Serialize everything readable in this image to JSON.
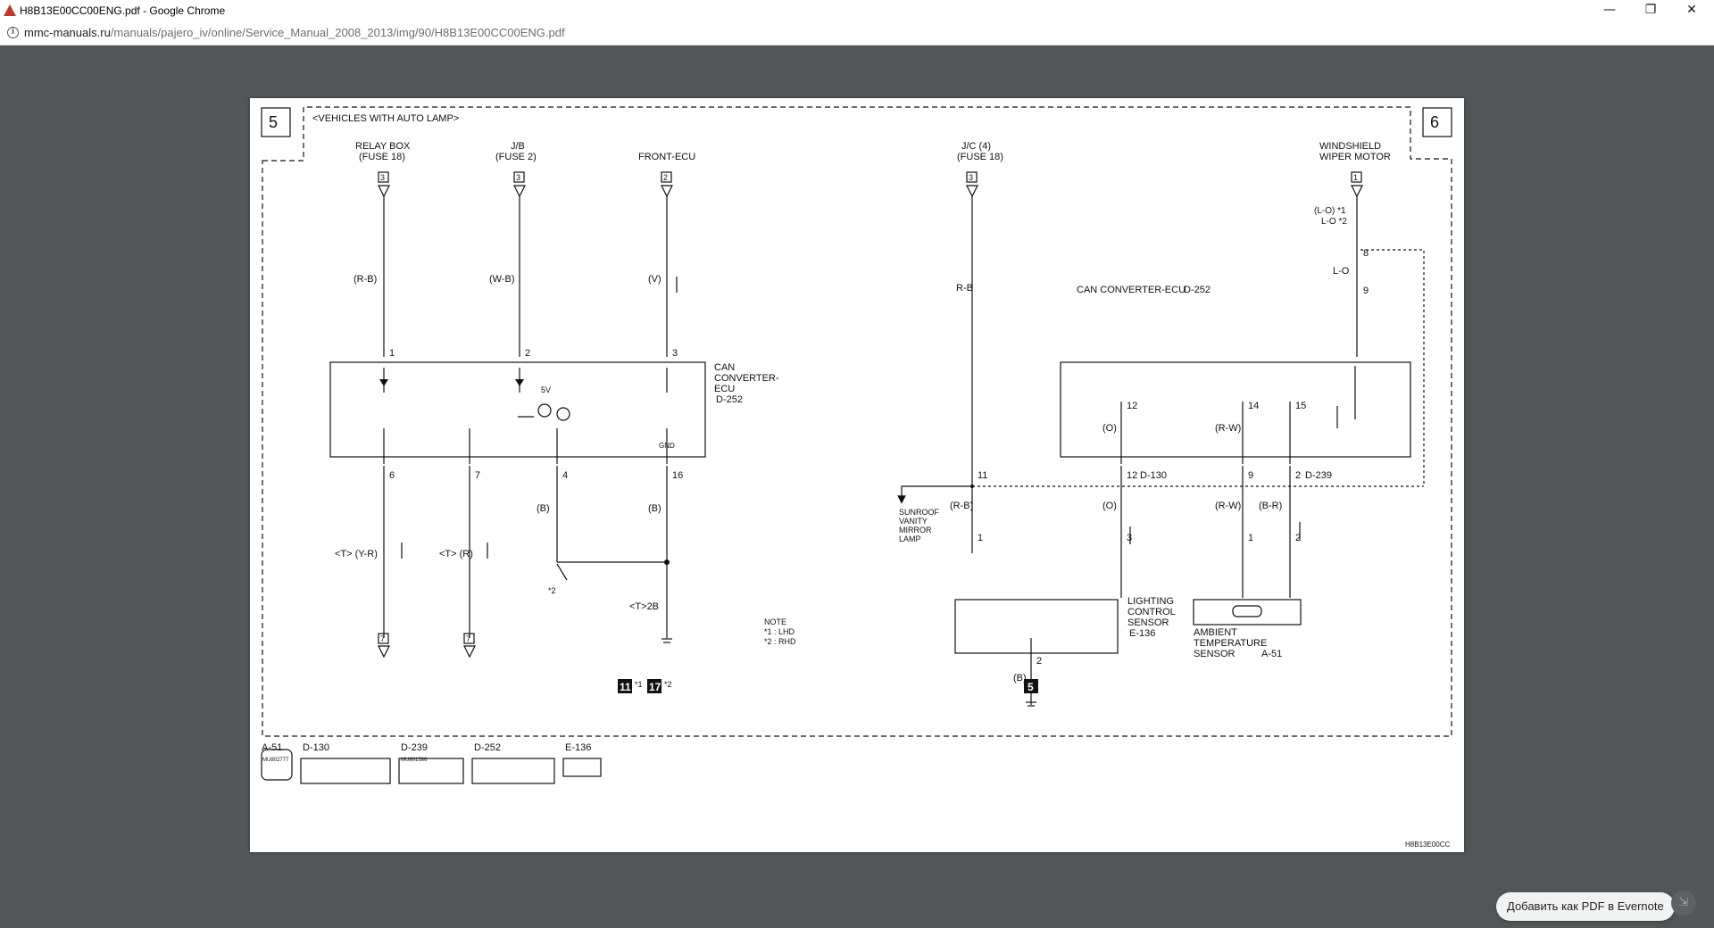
{
  "window": {
    "title": "H8B13E00CC00ENG.pdf - Google Chrome",
    "minimize": "—",
    "restore": "❐",
    "close": "✕"
  },
  "address": {
    "domain": "mmc-manuals.ru",
    "path": "/manuals/pajero_iv/online/Service_Manual_2008_2013/img/90/H8B13E00CC00ENG.pdf"
  },
  "diagram": {
    "page_left": "5",
    "page_right": "6",
    "variant": "<VEHICLES WITH AUTO LAMP>",
    "relay_box_1": "RELAY BOX",
    "relay_box_2": "(FUSE 18)",
    "jb_1": "J/B",
    "jb_2": "(FUSE 2)",
    "front_ecu": "FRONT-ECU",
    "jc_1": "J/C (4)",
    "jc_2": "(FUSE 18)",
    "wiper_1": "WINDSHIELD",
    "wiper_2": "WIPER MOTOR",
    "conn_3a": "3",
    "conn_3b": "3",
    "conn_2": "2",
    "conn_3c": "3",
    "conn_1": "1",
    "wire_rb": "(R-B)",
    "wire_wb": "(W-B)",
    "wire_v": "(V)",
    "wire_rb2": "R-B",
    "wire_lo1": "(L-O) *1",
    "wire_lo2": "L-O *2",
    "wire_lo3": "L-O",
    "pin_1": "1",
    "pin_2": "2",
    "pin_3": "3",
    "pin_8": "8",
    "pin_9": "9",
    "can_1": "CAN",
    "can_2": "CONVERTER-",
    "can_3": "ECU",
    "can_4": "D-252",
    "can_right": "CAN CONVERTER-ECU",
    "can_right_code": "D-252",
    "v5": "5V",
    "gnd": "GND",
    "pin_6": "6",
    "pin_7": "7",
    "pin_4": "4",
    "pin_16": "16",
    "pin_12": "12",
    "pin_14": "14",
    "pin_15": "15",
    "pin_11": "11",
    "pin_12b": "12",
    "code_d130": "D-130",
    "pin_9b": "9",
    "pin_2b": "2",
    "code_d239": "D-239",
    "wire_b1": "(B)",
    "wire_b2": "(B)",
    "wire_o1": "(O)",
    "wire_o2": "(O)",
    "wire_rw1": "(R-W)",
    "wire_rw2": "(R-W)",
    "wire_rb3": "(R-B)",
    "wire_br": "(B-R)",
    "wire_t_yr": "<T> (Y-R)",
    "wire_t_r": "<T> (R)",
    "wire_t2b": "<T>2B",
    "star2": "*2",
    "sunroof_1": "SUNROOF",
    "sunroof_2": "VANITY",
    "sunroof_3": "MIRROR",
    "sunroof_4": "LAMP",
    "pin_1c": "1",
    "pin_3c": "3",
    "pin_1d": "1",
    "pin_2d": "2",
    "lcs_1": "LIGHTING",
    "lcs_2": "CONTROL",
    "lcs_3": "SENSOR",
    "lcs_code": "E-136",
    "ats_1": "AMBIENT",
    "ats_2": "TEMPERATURE",
    "ats_3": "SENSOR",
    "ats_code": "A-51",
    "pin_2e": "2",
    "wire_b3": "(B)",
    "note_1": "NOTE",
    "note_2": "*1 : LHD",
    "note_3": "*2 : RHD",
    "conn_7a": "7",
    "conn_7b": "7",
    "gnd_11": "11",
    "gnd_11s": "*1",
    "gnd_17": "17",
    "gnd_17s": "*2",
    "gnd_5": "5",
    "lc_a51": "A-51",
    "lc_d130": "D-130",
    "lc_d239": "D-239",
    "lc_d252": "D-252",
    "lc_e136": "E-136",
    "lc_sub1": "MU802777",
    "lc_sub2": "MU801586",
    "doc_code": "H8B13E00CC"
  },
  "evernote_button": "Добавить как PDF в Evernote",
  "corner_icon": "⇲"
}
